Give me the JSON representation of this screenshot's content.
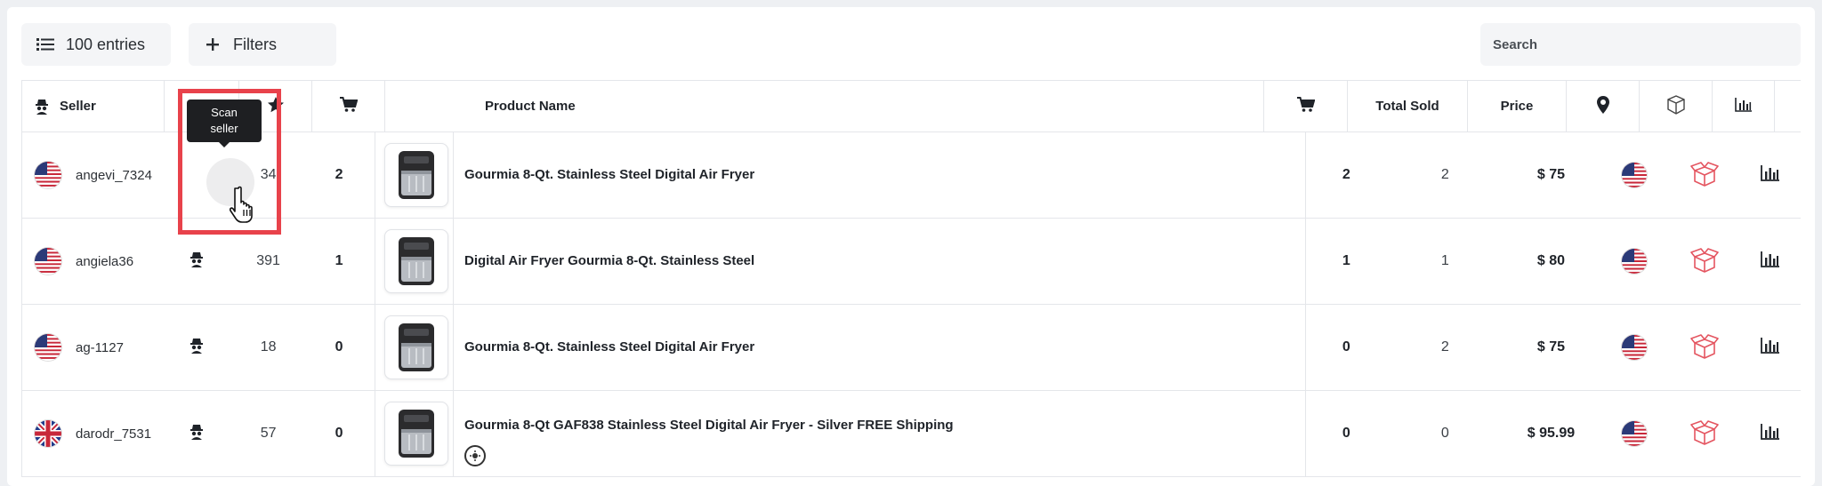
{
  "toolbar": {
    "entries_label": "100 entries",
    "filters_label": "Filters",
    "search_placeholder": "Search"
  },
  "columns": {
    "seller": "Seller",
    "product_name": "Product Name",
    "total_sold": "Total Sold",
    "price": "Price"
  },
  "tooltip": {
    "line1": "Scan",
    "line2": "seller"
  },
  "rows": [
    {
      "seller": "angevi_7324",
      "flag": "us",
      "rating": "34",
      "cart": "2",
      "product": "Gourmia 8-Qt. Stainless Steel Digital Air Fryer",
      "cart2": "2",
      "sold": "2",
      "price": "$ 75",
      "location_flag": "us"
    },
    {
      "seller": "angiela36",
      "flag": "us",
      "rating": "391",
      "cart": "1",
      "product": "Digital Air Fryer Gourmia 8-Qt. Stainless Steel",
      "cart2": "1",
      "sold": "1",
      "price": "$ 80",
      "location_flag": "us"
    },
    {
      "seller": "ag-1127",
      "flag": "us",
      "rating": "18",
      "cart": "0",
      "product": "Gourmia 8-Qt. Stainless Steel Digital Air Fryer",
      "cart2": "0",
      "sold": "2",
      "price": "$ 75",
      "location_flag": "us"
    },
    {
      "seller": "darodr_7531",
      "flag": "uk",
      "rating": "57",
      "cart": "0",
      "product": "Gourmia 8-Qt GAF838 Stainless Steel Digital Air Fryer - Silver FREE Shipping",
      "cart2": "0",
      "sold": "0",
      "price": "$ 95.99",
      "location_flag": "us"
    }
  ],
  "colors": {
    "accent_red": "#e8424b",
    "box_icon_red": "#e45560",
    "tooltip_bg": "#1e1f22"
  }
}
